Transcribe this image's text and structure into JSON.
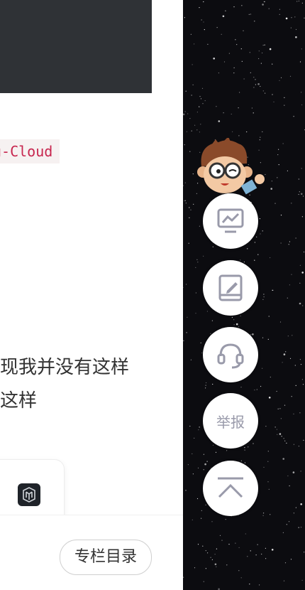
{
  "article": {
    "inline_code": "g-Cloud",
    "paragraph_line1": "现我并没有这样",
    "paragraph_line2": "这样"
  },
  "bottom_bar": {
    "toc_label": "专栏目录"
  },
  "sidebar": {
    "buttons": [
      {
        "icon": "monitor-chart-icon"
      },
      {
        "icon": "edit-note-icon"
      },
      {
        "icon": "headset-icon"
      },
      {
        "label": "举报"
      },
      {
        "icon": "back-to-top-icon"
      }
    ]
  },
  "colors": {
    "code_block_bg": "#2f3236",
    "inline_code_text": "#c7254e",
    "sidebar_bg": "#0c0c10",
    "icon_gray": "#999aaa"
  }
}
